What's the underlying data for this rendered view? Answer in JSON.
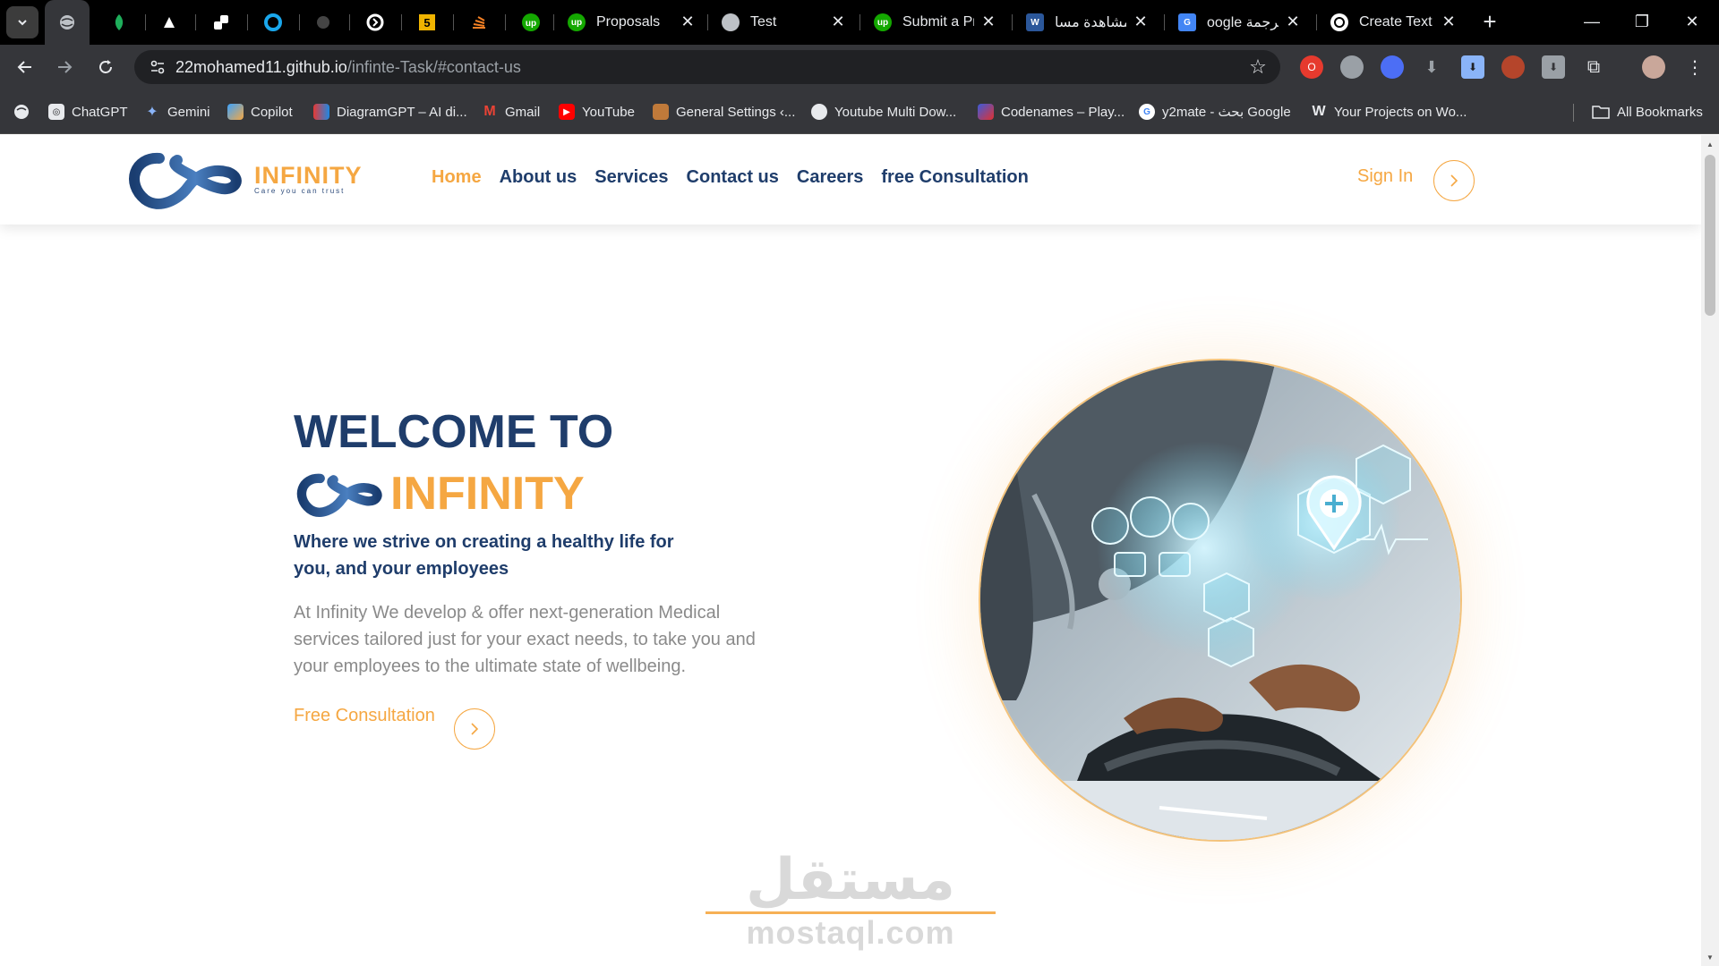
{
  "browser": {
    "tabs": [
      {
        "label": "Proposals",
        "favicon": "up"
      },
      {
        "label": "Test",
        "favicon": "globe"
      },
      {
        "label": "Submit a Pr",
        "favicon": "up"
      },
      {
        "label": "مشاهدة مسا",
        "favicon": "W"
      },
      {
        "label": "oogle ترجمة",
        "favicon": "G"
      },
      {
        "label": "Create Text",
        "favicon": "openai"
      }
    ],
    "new_tab_symbol": "+",
    "window_controls": [
      "—",
      "❐",
      "✕"
    ],
    "url": {
      "host": "22mohamed11.github.io",
      "path": "/infinte-Task/#contact-us"
    },
    "bookmarks": [
      {
        "label": "ChatGPT",
        "icon": "openai-icon"
      },
      {
        "label": "Gemini",
        "icon": "gemini-icon"
      },
      {
        "label": "Copilot",
        "icon": "copilot-icon"
      },
      {
        "label": "DiagramGPT – AI di...",
        "icon": "diagram-icon"
      },
      {
        "label": "Gmail",
        "icon": "gmail-icon"
      },
      {
        "label": "YouTube",
        "icon": "youtube-icon"
      },
      {
        "label": "General Settings ‹...",
        "icon": "settings-icon"
      },
      {
        "label": "Youtube Multi Dow...",
        "icon": "globe-icon"
      },
      {
        "label": "Codenames – Play...",
        "icon": "codenames-icon"
      },
      {
        "label": "y2mate - بحث Google",
        "icon": "google-icon"
      },
      {
        "label": "Your Projects on Wo...",
        "icon": "wordpress-icon"
      }
    ],
    "all_bookmarks": "All Bookmarks"
  },
  "site": {
    "logo": {
      "name": "INFINITY",
      "tagline": "Care you can trust"
    },
    "nav": [
      {
        "label": "Home",
        "active": true
      },
      {
        "label": "About us",
        "active": false
      },
      {
        "label": "Services",
        "active": false
      },
      {
        "label": "Contact us",
        "active": false
      },
      {
        "label": "Careers",
        "active": false
      },
      {
        "label": "free Consultation",
        "active": false
      }
    ],
    "sign_in": "Sign In",
    "hero": {
      "title": "WELCOME TO",
      "brand": "INFINITY",
      "subtitle": "Where we strive on creating a healthy life for you, and your employees",
      "description": "At Infinity We develop & offer next-generation Medical services tailored just for your exact needs, to take you and your employees to the ultimate state of wellbeing.",
      "cta": "Free Consultation"
    },
    "watermark": {
      "arabic": "مستقل",
      "latin": "mostaql.com"
    }
  },
  "colors": {
    "accent": "#f5a742",
    "navy": "#1f3d6b",
    "muted": "#8a8a8a"
  }
}
